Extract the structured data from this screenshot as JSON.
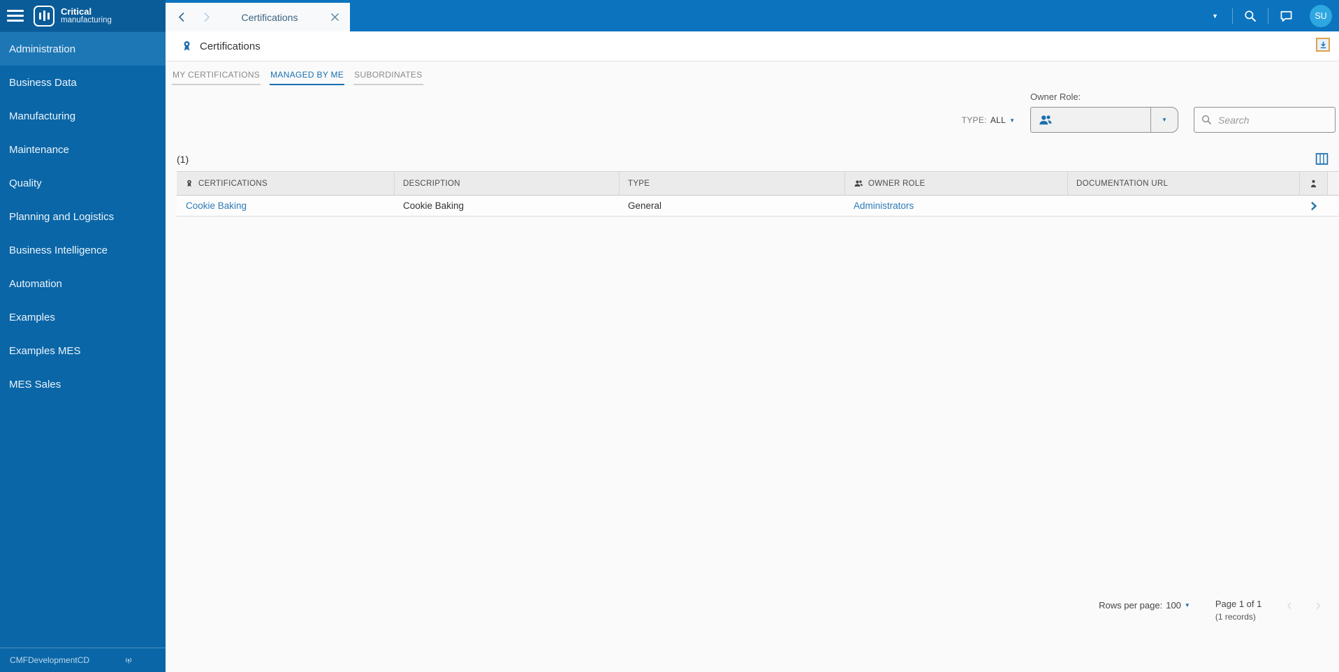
{
  "app": {
    "brand_top": "Critical",
    "brand_bottom": "manufacturing",
    "avatar_initials": "SU",
    "environment": "CMFDevelopmentCD"
  },
  "sidebar": {
    "items": [
      {
        "label": "Administration",
        "active": true
      },
      {
        "label": "Business Data",
        "active": false
      },
      {
        "label": "Manufacturing",
        "active": false
      },
      {
        "label": "Maintenance",
        "active": false
      },
      {
        "label": "Quality",
        "active": false
      },
      {
        "label": "Planning and Logistics",
        "active": false
      },
      {
        "label": "Business Intelligence",
        "active": false
      },
      {
        "label": "Automation",
        "active": false
      },
      {
        "label": "Examples",
        "active": false
      },
      {
        "label": "Examples MES",
        "active": false
      },
      {
        "label": "MES Sales",
        "active": false
      }
    ]
  },
  "tabbar": {
    "tab_title": "Certifications"
  },
  "breadcrumb": {
    "title": "Certifications"
  },
  "subtabs": [
    {
      "label": "MY CERTIFICATIONS",
      "active": false
    },
    {
      "label": "MANAGED BY ME",
      "active": true
    },
    {
      "label": "SUBORDINATES",
      "active": false
    }
  ],
  "filters": {
    "type_label": "TYPE:",
    "type_value": "ALL",
    "owner_role_label": "Owner Role:",
    "search_placeholder": "Search"
  },
  "grid": {
    "count": "(1)",
    "columns": [
      "CERTIFICATIONS",
      "DESCRIPTION",
      "TYPE",
      "OWNER ROLE",
      "DOCUMENTATION URL"
    ],
    "rows": [
      {
        "certifications": "Cookie Baking",
        "description": "Cookie Baking",
        "type": "General",
        "owner_role": "Administrators",
        "documentation_url": ""
      }
    ]
  },
  "pagination": {
    "rows_per_page_label": "Rows per page:",
    "rows_per_page_value": "100",
    "page_info": "Page 1 of 1",
    "records_info": "(1 records)"
  },
  "icons": {
    "caret_down": "▼",
    "chevron_left": "‹",
    "chevron_right": "›"
  },
  "colors": {
    "topbar": "#0c74bf",
    "sidebar": "#0a66a7",
    "sidebar_header": "#0a5c99",
    "sidebar_active": "#1d77b5",
    "accent": "#1a6fae",
    "link": "#2d7ab9",
    "avatar": "#2ea6e0",
    "export_border": "#dfa14c"
  }
}
